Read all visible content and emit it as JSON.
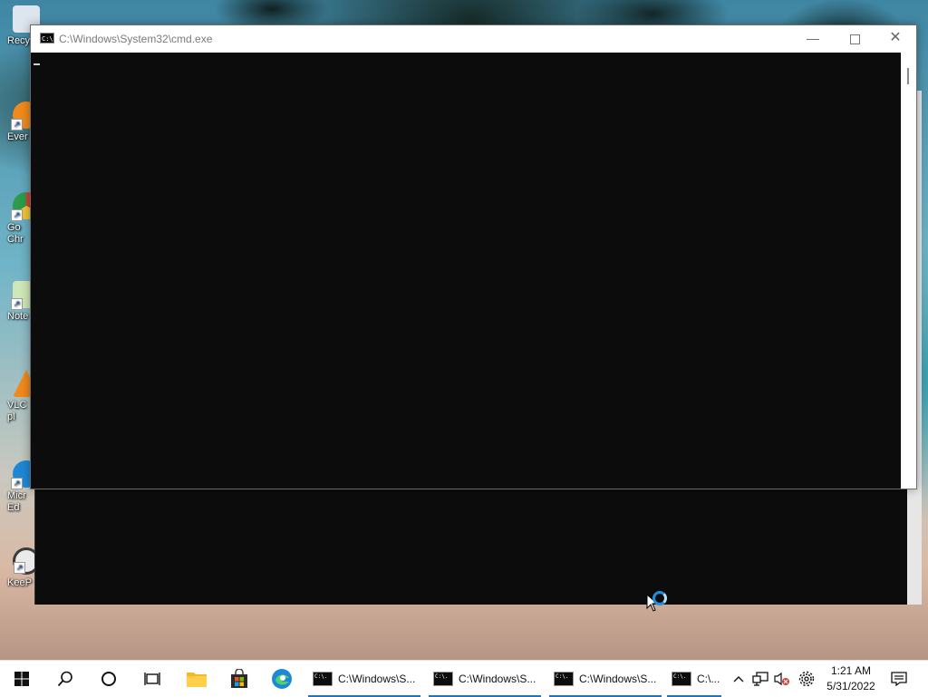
{
  "desktop": {
    "icons": [
      {
        "label": "Recy",
        "icon": "recycle-bin-icon",
        "color": "#dde6ef"
      },
      {
        "label": "Ever",
        "icon": "everything-search-icon",
        "color": "#f08a1c"
      },
      {
        "label": "Go\nChr",
        "icon": "chrome-icon",
        "color": "#e03d2f"
      },
      {
        "label": "Note",
        "icon": "notepad-plus-icon",
        "color": "#cfe7b8"
      },
      {
        "label": "VLC\npl",
        "icon": "vlc-icon",
        "color": "#f08a1c"
      },
      {
        "label": "Micr\nEd",
        "icon": "edge-icon",
        "color": "#1e88d6"
      },
      {
        "label": "KeeP",
        "icon": "keepass-icon",
        "color": "#3a3a3a"
      }
    ]
  },
  "window": {
    "title": "C:\\Windows\\System32\\cmd.exe",
    "icon": "cmd-icon",
    "icon_text": "C:\\.",
    "minimize_glyph": "—",
    "close_glyph": "✕",
    "console_bg": "#0c0c0c"
  },
  "taskbar": {
    "start_icon": "windows-start-icon",
    "search_icon": "search-icon",
    "cortana_icon": "cortana-icon",
    "taskview_icon": "task-view-icon",
    "pinned": [
      "file-explorer-icon",
      "microsoft-store-icon",
      "edge-icon"
    ],
    "apps": [
      {
        "label": "C:\\Windows\\S...",
        "active": true
      },
      {
        "label": "C:\\Windows\\S...",
        "active": true
      },
      {
        "label": "C:\\Windows\\S...",
        "active": true
      },
      {
        "label": "C:\\...",
        "active": true
      }
    ],
    "tray": {
      "chevron": "^",
      "icons": [
        "network-icon",
        "volume-muted-icon",
        "settings-gear-icon"
      ]
    },
    "clock": {
      "time": "1:21 AM",
      "date": "5/31/2022"
    },
    "accent": "#1a73c9"
  }
}
